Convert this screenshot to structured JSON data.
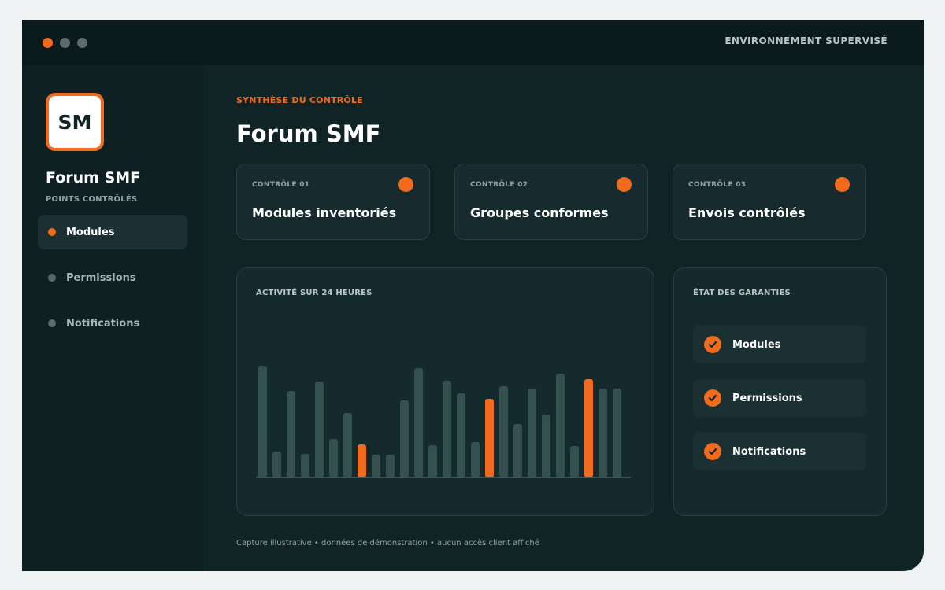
{
  "titlebar": {
    "env_label": "ENVIRONNEMENT SUPERVISÉ",
    "dots": [
      "#f26b1d",
      "#5c6a6b",
      "#5c6a6b"
    ]
  },
  "sidebar": {
    "logo_text": "SM",
    "title": "Forum SMF",
    "subtitle": "POINTS CONTRÔLÉS",
    "items": [
      {
        "label": "Modules",
        "active": true
      },
      {
        "label": "Permissions",
        "active": false
      },
      {
        "label": "Notifications",
        "active": false
      }
    ]
  },
  "main": {
    "kicker": "SYNTHÈSE DU CONTRÔLE",
    "title": "Forum SMF",
    "cards": [
      {
        "kicker": "CONTRÔLE 01",
        "title": "Modules inventoriés"
      },
      {
        "kicker": "CONTRÔLE 02",
        "title": "Groupes conformes"
      },
      {
        "kicker": "CONTRÔLE 03",
        "title": "Envois contrôlés"
      }
    ],
    "activity_title": "ACTIVITÉ SUR 24 HEURES",
    "guarantees_title": "ÉTAT DES GARANTIES",
    "guarantees": [
      {
        "label": "Modules",
        "icon": "check-icon"
      },
      {
        "label": "Permissions",
        "icon": "check-icon"
      },
      {
        "label": "Notifications",
        "icon": "check-icon"
      }
    ],
    "footer": "Capture illustrative • données de démonstration • aucun accès client affiché"
  },
  "colors": {
    "accent": "#f26b1d",
    "bar": "#34504f",
    "background": "#102325"
  },
  "chart_data": {
    "type": "bar",
    "values": [
      142,
      33,
      110,
      30,
      122,
      49,
      82,
      42,
      29,
      29,
      98,
      139,
      41,
      123,
      107,
      45,
      100,
      116,
      68,
      113,
      80,
      132,
      40,
      125,
      113,
      113
    ],
    "highlighted": [
      7,
      16,
      23
    ],
    "ylim": [
      0,
      150
    ]
  }
}
